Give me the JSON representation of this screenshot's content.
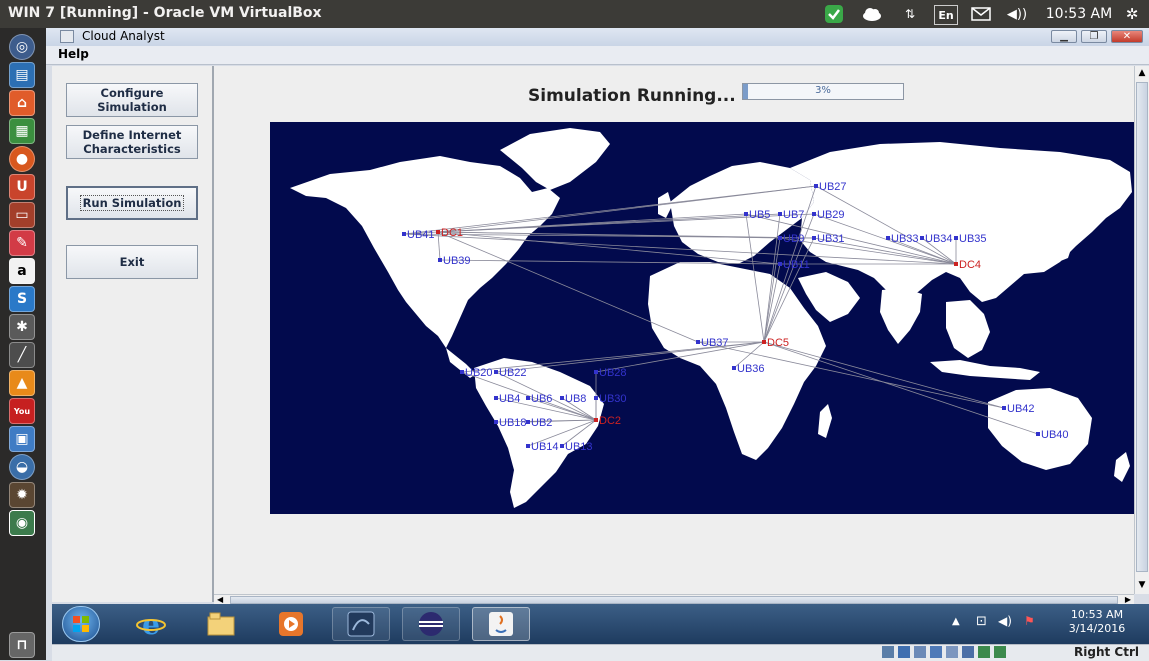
{
  "top_panel": {
    "title": "WIN 7 [Running] - Oracle VM VirtualBox",
    "keyboard_layout": "En",
    "time": "10:53 AM"
  },
  "window": {
    "title": "Cloud Analyst",
    "menu": [
      "Help"
    ]
  },
  "sidebar": {
    "buttons": [
      {
        "label": "Configure\nSimulation"
      },
      {
        "label": "Define Internet\nCharacteristics"
      },
      {
        "label": "Run Simulation"
      },
      {
        "label": "Exit"
      }
    ]
  },
  "status": {
    "text": "Simulation Running...",
    "progress_label": "3%",
    "progress_value": 0.03
  },
  "map": {
    "background_color": "#020a4d",
    "land_color": "#ffffff",
    "user_base_color": "#3333cc",
    "datacenter_color": "#cc2222",
    "datacenters": [
      "DC1",
      "DC2",
      "DC4",
      "DC5"
    ],
    "user_bases": [
      "UB41",
      "UB39",
      "UB27",
      "UB29",
      "UB31",
      "UB33",
      "UB34",
      "UB35",
      "UB11",
      "UB5",
      "UB7",
      "UB9",
      "UB37",
      "UB36",
      "UB20",
      "UB22",
      "UB4",
      "UB6",
      "UB8",
      "UB30",
      "UB2",
      "UB28",
      "UB18",
      "UB14",
      "UB13",
      "UB42",
      "UB40"
    ]
  },
  "taskbar": {
    "time": "10:53 AM",
    "date": "3/14/2016"
  },
  "vbox_status": {
    "host_key": "Right Ctrl"
  },
  "colors": {
    "ubuntu_panel": "#3c3b37",
    "launcher": "#2b2a29",
    "taskbar": "#2a4a70"
  }
}
